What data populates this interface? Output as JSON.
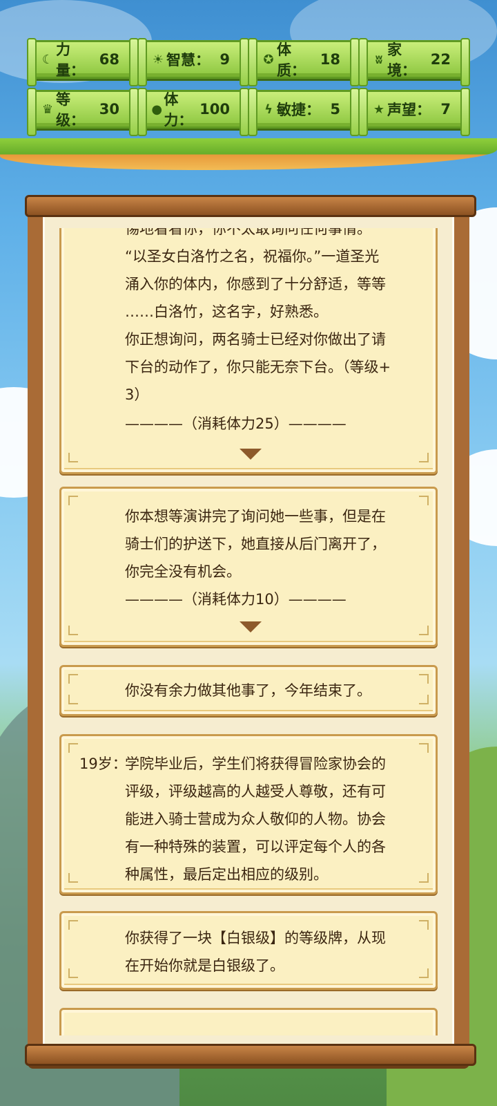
{
  "stats": [
    {
      "icon": "strength-icon",
      "glyph": "☾",
      "label": "力量：",
      "value": "68"
    },
    {
      "icon": "wisdom-icon",
      "glyph": "☀",
      "label": "智慧：",
      "value": "9"
    },
    {
      "icon": "constitution-icon",
      "glyph": "✪",
      "label": "体质：",
      "value": "18"
    },
    {
      "icon": "family-icon",
      "glyph": "ʬ",
      "label": "家境：",
      "value": "22"
    },
    {
      "icon": "level-icon",
      "glyph": "♛",
      "label": "等级：",
      "value": "30"
    },
    {
      "icon": "stamina-icon",
      "glyph": "●",
      "label": "体力：",
      "value": "100"
    },
    {
      "icon": "agility-icon",
      "glyph": "ϟ",
      "label": "敏捷：",
      "value": "5"
    },
    {
      "icon": "reputation-icon",
      "glyph": "★",
      "label": "声望：",
      "value": "7"
    }
  ],
  "cards": [
    {
      "lines": [
        "惕地看看你，你不太敢询问任何事情。",
        "“以圣女白洛竹之名，祝福你。”一道圣光",
        "涌入你的体内，你感到了十分舒适，等等",
        "……白洛竹，这名字，好熟悉。",
        "你正想询问，两名骑士已经对你做出了请",
        "下台的动作了，你只能无奈下台。（等级+",
        "3）"
      ],
      "cost": "————（消耗体力25）————"
    },
    {
      "lines": [
        "你本想等演讲完了询问她一些事，但是在",
        "骑士们的护送下，她直接从后门离开了，",
        "你完全没有机会。"
      ],
      "cost": "————（消耗体力10）————"
    },
    {
      "lines": [
        "你没有余力做其他事了，今年结束了。"
      ]
    },
    {
      "age": "19岁：",
      "lines": [
        "学院毕业后，学生们将获得冒险家协会的",
        "评级，评级越高的人越受人尊敬，还有可",
        "能进入骑士营成为众人敬仰的人物。协会",
        "有一种特殊的装置，可以评定每个人的各",
        "种属性，最后定出相应的级别。"
      ]
    },
    {
      "lines": [
        "你获得了一块【白银级】的等级牌，从现",
        "在开始你就是白银级了。"
      ]
    }
  ]
}
